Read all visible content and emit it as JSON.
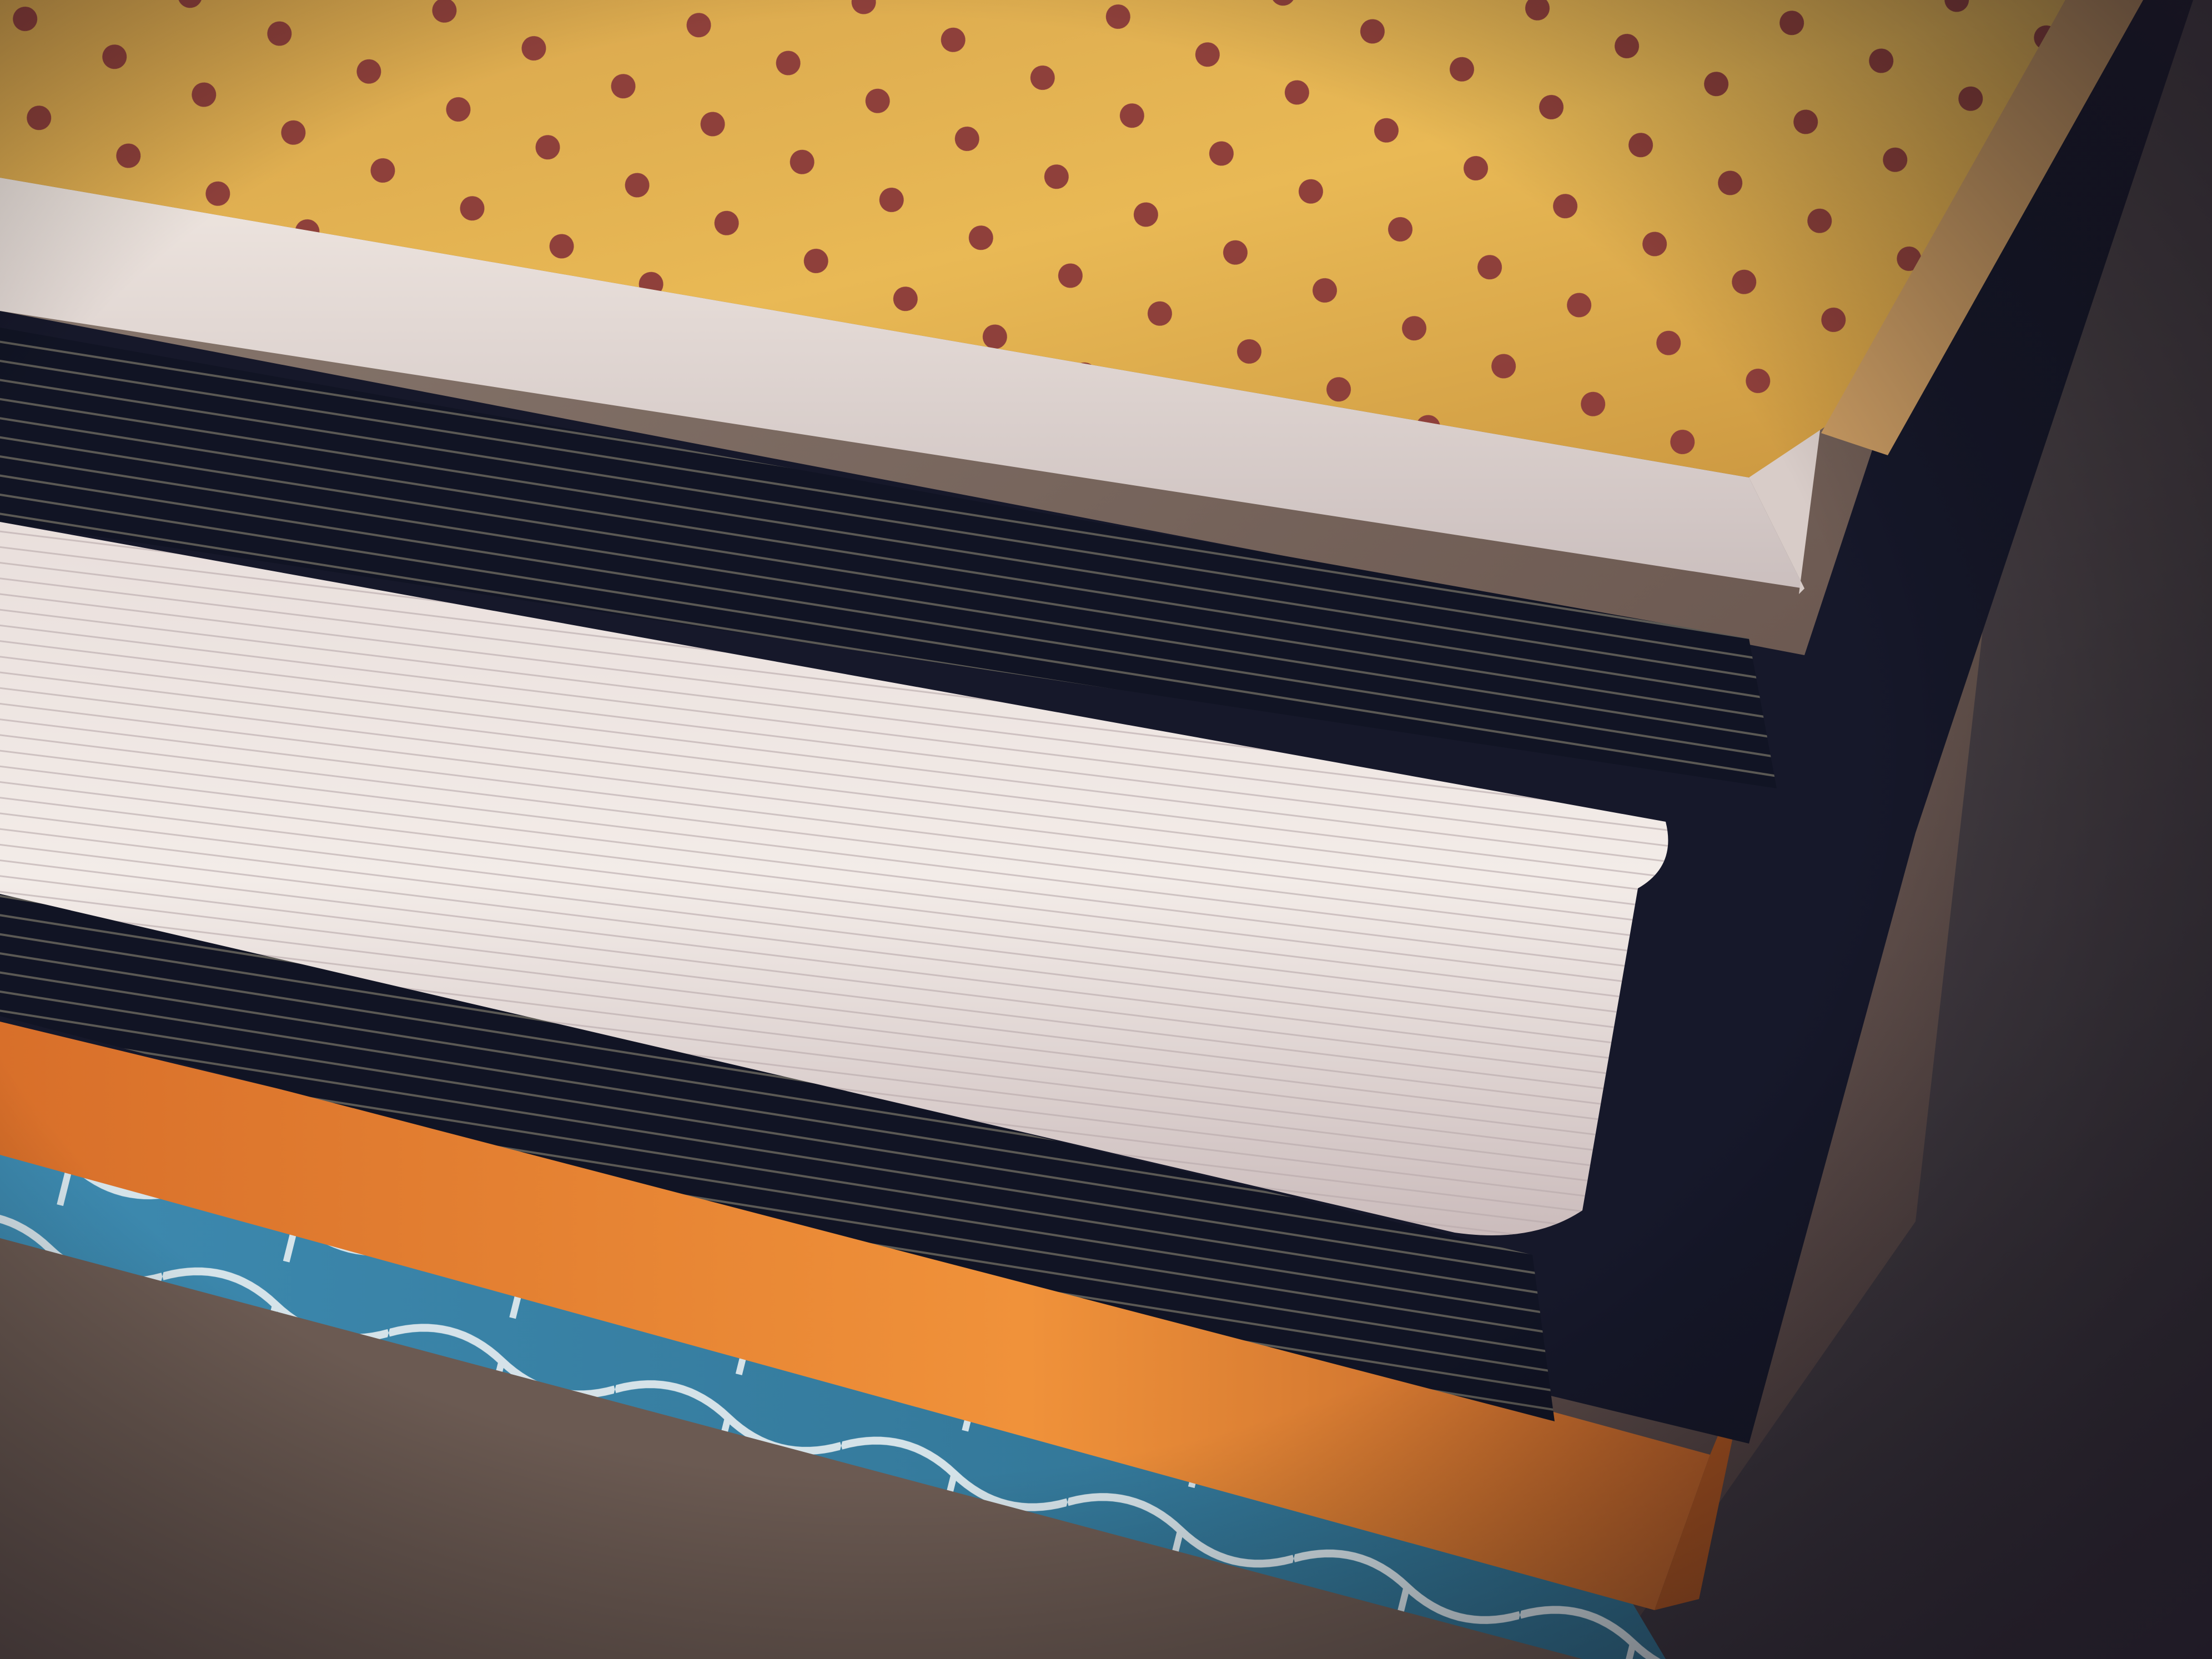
{
  "image": {
    "subject": "",
    "objects": [
      {
        "name": "polka-dot-notebook",
        "cover_color": "#e0b24a",
        "dot_color": "#8a3a3a"
      },
      {
        "name": "black-hardcover-book",
        "cover_color": "#16182a",
        "page_color": "#e8e0dc"
      },
      {
        "name": "orange-book",
        "cover_color": "#e07a28"
      },
      {
        "name": "blue-patterned-book",
        "cover_color": "#3a86a8",
        "pattern_color": "#e6edf0"
      }
    ],
    "palette": {
      "table": "#7a675d",
      "shadow": "#1b2332",
      "vignette": "#1a1420"
    }
  }
}
